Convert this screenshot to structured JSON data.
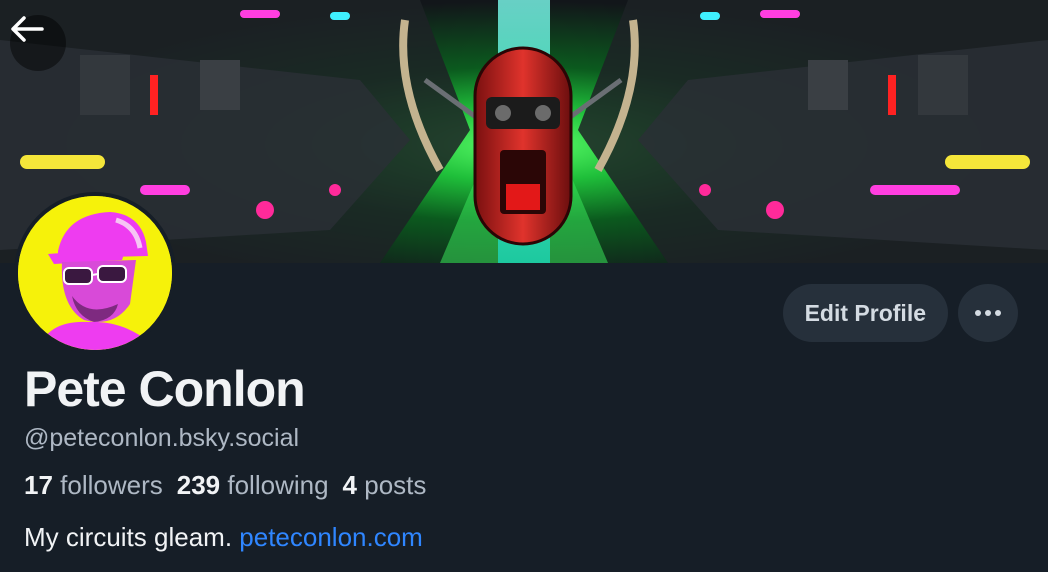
{
  "profile": {
    "display_name": "Pete Conlon",
    "handle": "@peteconlon.bsky.social",
    "bio_text": "My circuits gleam.",
    "bio_link": "peteconlon.com"
  },
  "stats": {
    "followers_count": "17",
    "followers_label": "followers",
    "following_count": "239",
    "following_label": "following",
    "posts_count": "4",
    "posts_label": "posts"
  },
  "actions": {
    "edit_label": "Edit Profile",
    "more_icon": "ellipsis-icon"
  },
  "nav": {
    "back_icon": "arrow-left-icon"
  },
  "colors": {
    "background": "#161e27",
    "button_bg": "#26303b",
    "link": "#2f86ff",
    "muted_text": "#aeb8c4",
    "avatar_bg": "#f6f20a",
    "avatar_magenta": "#ee3cf0"
  }
}
